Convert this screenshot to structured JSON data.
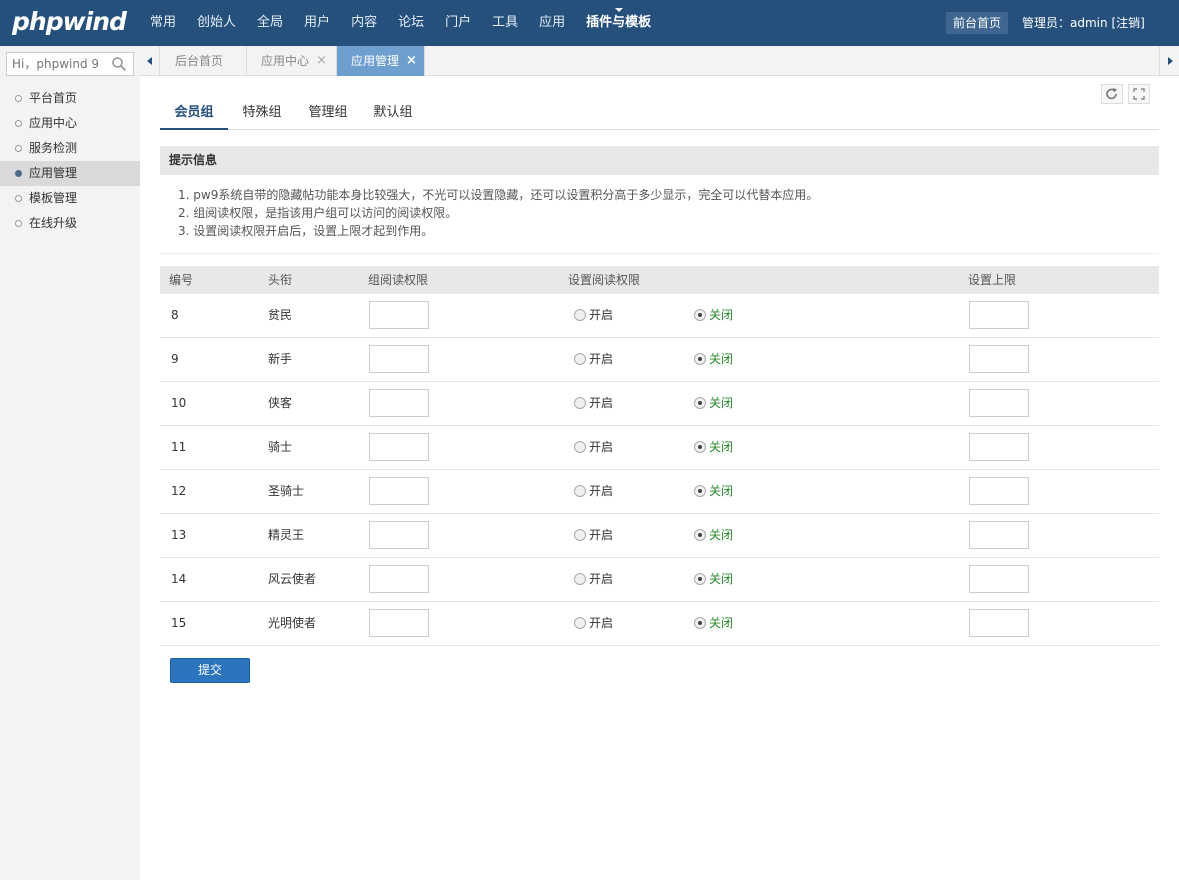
{
  "header": {
    "logo": "phpwind",
    "nav": [
      {
        "label": "常用",
        "active": false
      },
      {
        "label": "创始人",
        "active": false
      },
      {
        "label": "全局",
        "active": false
      },
      {
        "label": "用户",
        "active": false
      },
      {
        "label": "内容",
        "active": false
      },
      {
        "label": "论坛",
        "active": false
      },
      {
        "label": "门户",
        "active": false
      },
      {
        "label": "工具",
        "active": false
      },
      {
        "label": "应用",
        "active": false
      },
      {
        "label": "插件与模板",
        "active": true
      }
    ],
    "front_label": "前台首页",
    "admin_label": "管理员：",
    "admin_name": "admin",
    "logout_label": "[注销]"
  },
  "sidebar": {
    "search_placeholder": "Hi，phpwind 9",
    "items": [
      {
        "label": "平台首页",
        "active": false
      },
      {
        "label": "应用中心",
        "active": false
      },
      {
        "label": "服务检测",
        "active": false
      },
      {
        "label": "应用管理",
        "active": true
      },
      {
        "label": "模板管理",
        "active": false
      },
      {
        "label": "在线升级",
        "active": false
      }
    ]
  },
  "tabs": [
    {
      "label": "后台首页",
      "closable": false,
      "active": false
    },
    {
      "label": "应用中心",
      "closable": true,
      "active": false
    },
    {
      "label": "应用管理",
      "closable": true,
      "active": true
    }
  ],
  "tab_close_glyph": "×",
  "subtabs": [
    {
      "label": "会员组",
      "active": true
    },
    {
      "label": "特殊组",
      "active": false
    },
    {
      "label": "管理组",
      "active": false
    },
    {
      "label": "默认组",
      "active": false
    }
  ],
  "tips": {
    "title": "提示信息",
    "items": [
      "1.  pw9系统自带的隐藏帖功能本身比较强大，不光可以设置隐藏，还可以设置积分高于多少显示，完全可以代替本应用。",
      "2.  组阅读权限，是指该用户组可以访问的阅读权限。",
      "3.  设置阅读权限开启后，设置上限才起到作用。"
    ]
  },
  "table": {
    "headers": {
      "id": "编号",
      "title": "头衔",
      "read_perm": "组阅读权限",
      "set_read_perm": "设置阅读权限",
      "limit": "设置上限"
    },
    "radio_on_label": "开启",
    "radio_off_label": "关闭",
    "rows": [
      {
        "id": "8",
        "title": "贫民",
        "read_perm": "",
        "setting": "off",
        "limit": ""
      },
      {
        "id": "9",
        "title": "新手",
        "read_perm": "",
        "setting": "off",
        "limit": ""
      },
      {
        "id": "10",
        "title": "侠客",
        "read_perm": "",
        "setting": "off",
        "limit": ""
      },
      {
        "id": "11",
        "title": "骑士",
        "read_perm": "",
        "setting": "off",
        "limit": ""
      },
      {
        "id": "12",
        "title": "圣骑士",
        "read_perm": "",
        "setting": "off",
        "limit": ""
      },
      {
        "id": "13",
        "title": "精灵王",
        "read_perm": "",
        "setting": "off",
        "limit": ""
      },
      {
        "id": "14",
        "title": "风云使者",
        "read_perm": "",
        "setting": "off",
        "limit": ""
      },
      {
        "id": "15",
        "title": "光明使者",
        "read_perm": "",
        "setting": "off",
        "limit": ""
      }
    ]
  },
  "submit_label": "提交",
  "colors": {
    "header_bg": "#25507c",
    "active_tab_bg": "#6e9fcf",
    "submit_bg": "#2a75bd",
    "off_label": "#2a8a2a"
  }
}
